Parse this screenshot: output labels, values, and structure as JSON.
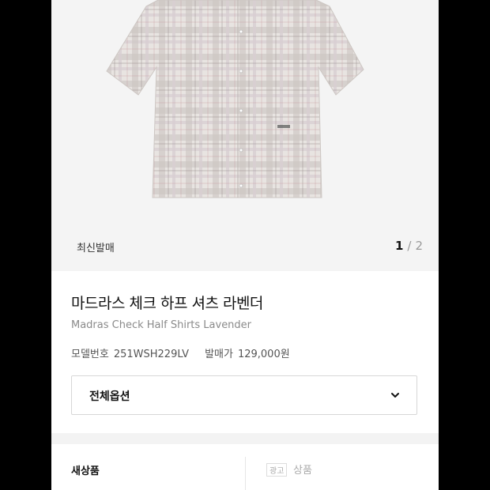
{
  "gallery": {
    "badge": "최신발매",
    "page_current": "1",
    "page_sep": "/",
    "page_total": "2"
  },
  "product": {
    "title_ko": "마드라스 체크 하프 셔츠 라벤더",
    "title_en": "Madras Check Half Shirts Lavender",
    "model_label": "모델번호",
    "model_number": "251WSH229LV",
    "price_label": "발매가",
    "price": "129,000원"
  },
  "options": {
    "label": "전체옵션",
    "icon": "chevron-down-icon"
  },
  "bottom_tabs": {
    "new_label": "새상품",
    "ad_tag": "광고",
    "used_label": "상품"
  },
  "colors": {
    "background": "#000000",
    "panel": "#ffffff",
    "gallery_bg": "#f4f4f4",
    "shirt_base": "#e6e1dd"
  }
}
